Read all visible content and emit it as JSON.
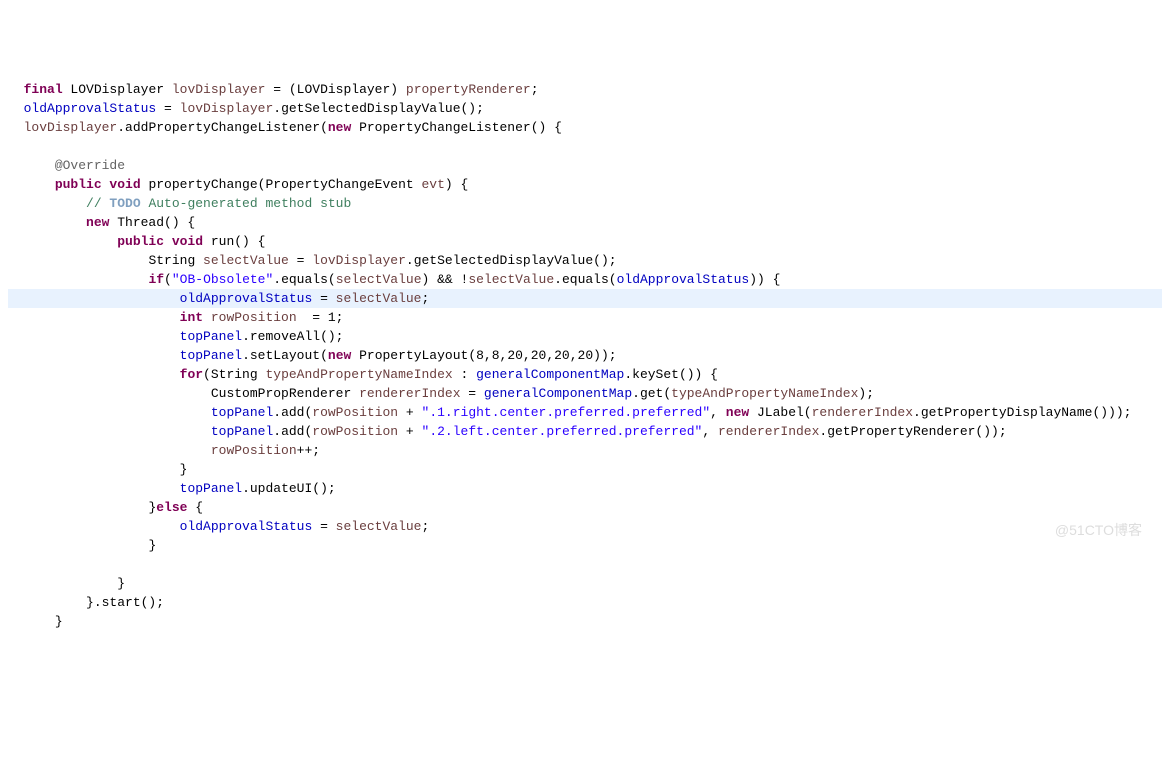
{
  "code": {
    "l1_final": "final",
    "l1_type": " LOVDisplayer ",
    "l1_var": "lovDisplayer",
    "l1_rest": " = (LOVDisplayer) ",
    "l1_prop": "propertyRenderer",
    "l1_end": ";",
    "l2_var": "oldApprovalStatus",
    "l2_rest": " = ",
    "l2_var2": "lovDisplayer",
    "l2_method": ".getSelectedDisplayValue();",
    "l3_var": "lovDisplayer",
    "l3_method": ".addPropertyChangeListener(",
    "l3_new": "new",
    "l3_rest": " PropertyChangeListener() {",
    "l5_anno": "@Override",
    "l6_public": "public",
    "l6_void": " void",
    "l6_name": " propertyChange(PropertyChangeEvent ",
    "l6_param": "evt",
    "l6_end": ") {",
    "l7_slash": "// ",
    "l7_todo": "TODO",
    "l7_comment": " Auto-generated method stub",
    "l8_new": "new",
    "l8_rest": " Thread() {",
    "l9_public": "public",
    "l9_void": " void",
    "l9_run": " run() {",
    "l10_pre": "String ",
    "l10_var": "selectValue",
    "l10_rest": " = ",
    "l10_var2": "lovDisplayer",
    "l10_method": ".getSelectedDisplayValue();",
    "l11_if": "if",
    "l11_open": "(",
    "l11_str": "\"OB-Obsolete\"",
    "l11_rest1": ".equals(",
    "l11_var1": "selectValue",
    "l11_rest2": ") && !",
    "l11_var2": "selectValue",
    "l11_rest3": ".equals(",
    "l11_var3": "oldApprovalStatus",
    "l11_rest4": ")) {",
    "l12_var": "oldApprovalStatus",
    "l12_rest": " = ",
    "l12_var2": "selectValue",
    "l12_end": ";",
    "l13_int": "int",
    "l13_var": " rowPosition",
    "l13_rest": "  = 1;",
    "l14_var": "topPanel",
    "l14_rest": ".removeAll();",
    "l15_var": "topPanel",
    "l15_rest": ".setLayout(",
    "l15_new": "new",
    "l15_rest2": " PropertyLayout(8,8,20,20,20,20));",
    "l16_for": "for",
    "l16_rest1": "(String ",
    "l16_var1": "typeAndPropertyNameIndex",
    "l16_rest2": " : ",
    "l16_var2": "generalComponentMap",
    "l16_rest3": ".keySet()) {",
    "l17_pre": "CustomPropRenderer ",
    "l17_var": "rendererIndex",
    "l17_rest": " = ",
    "l17_var2": "generalComponentMap",
    "l17_rest2": ".get(",
    "l17_var3": "typeAndPropertyNameIndex",
    "l17_end": ");",
    "l18_var": "topPanel",
    "l18_rest": ".add(",
    "l18_var2": "rowPosition",
    "l18_rest2": " + ",
    "l18_str": "\".1.right.center.preferred.preferred\"",
    "l18_rest3": ", ",
    "l18_new": "new",
    "l18_rest4": " JLabel(",
    "l18_var3": "rendererIndex",
    "l18_rest5": ".getPropertyDisplayName()));",
    "l19_var": "topPanel",
    "l19_rest": ".add(",
    "l19_var2": "rowPosition",
    "l19_rest2": " + ",
    "l19_str": "\".2.left.center.preferred.preferred\"",
    "l19_rest3": ", ",
    "l19_var3": "rendererIndex",
    "l19_rest4": ".getPropertyRenderer());",
    "l20_var": "rowPosition",
    "l20_rest": "++;",
    "l21_brace": "}",
    "l22_var": "topPanel",
    "l22_rest": ".updateUI();",
    "l23_else": "}",
    "l23_else2": "else",
    "l23_rest": " {",
    "l24_var": "oldApprovalStatus",
    "l24_rest": " = ",
    "l24_var2": "selectValue",
    "l24_end": ";",
    "l25_brace": "}",
    "l27_brace": "}",
    "l28_rest": "}.start();",
    "l29_brace": "}"
  },
  "watermark": "@51CTO博客"
}
